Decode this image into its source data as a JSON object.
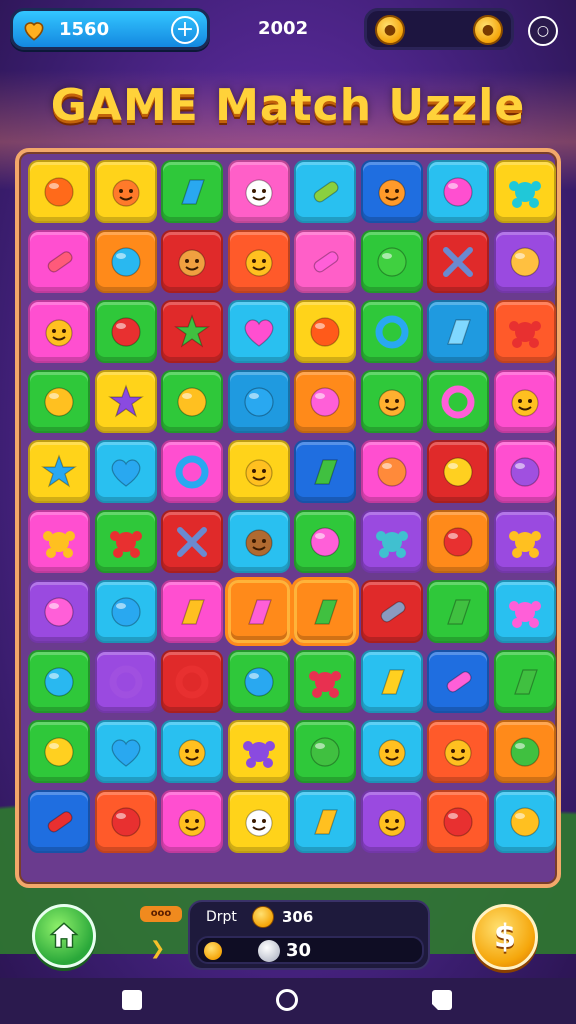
{
  "header": {
    "lives_value": "1560",
    "center_value": "2002",
    "title": "GAME Match Uzzle"
  },
  "board": {
    "rows": [
      [
        {
          "c": "#ffd31a",
          "i": "orange-fruit"
        },
        {
          "c": "#ffd31a",
          "i": "smile-pumpkin"
        },
        {
          "c": "#2fc83a",
          "i": "lightning-shape"
        },
        {
          "c": "#ff5fc8",
          "i": "cat-face"
        },
        {
          "c": "#29c0f0",
          "i": "sticks"
        },
        {
          "c": "#1f6ee0",
          "i": "round-creature"
        },
        {
          "c": "#29c0f0",
          "i": "pink-blob"
        },
        {
          "c": "#ffd31a",
          "i": "teal-flower"
        }
      ],
      [
        {
          "c": "#ff4fd0",
          "i": "brush"
        },
        {
          "c": "#ff8a1a",
          "i": "blue-orb"
        },
        {
          "c": "#e02a2a",
          "i": "monster-face"
        },
        {
          "c": "#ff5a2a",
          "i": "sun-face"
        },
        {
          "c": "#ff5fc8",
          "i": "pink-bar"
        },
        {
          "c": "#2fc83a",
          "i": "green-orb"
        },
        {
          "c": "#e02a2a",
          "i": "cross-swords"
        },
        {
          "c": "#9a4ae0",
          "i": "hand-glove"
        }
      ],
      [
        {
          "c": "#ff4fd0",
          "i": "smile-drop"
        },
        {
          "c": "#2fc83a",
          "i": "red-ball"
        },
        {
          "c": "#e02a2a",
          "i": "green-star"
        },
        {
          "c": "#29c0f0",
          "i": "heart"
        },
        {
          "c": "#ffd31a",
          "i": "orange-ball"
        },
        {
          "c": "#2fc83a",
          "i": "blue-ring"
        },
        {
          "c": "#1f9ae0",
          "i": "blue-gem"
        },
        {
          "c": "#ff5a2a",
          "i": "red-splat"
        }
      ],
      [
        {
          "c": "#2fc83a",
          "i": "lemon"
        },
        {
          "c": "#ffd31a",
          "i": "purple-star"
        },
        {
          "c": "#2fc83a",
          "i": "swirl-disc"
        },
        {
          "c": "#1f9ae0",
          "i": "blue-ball"
        },
        {
          "c": "#ff8a1a",
          "i": "pink-swirl"
        },
        {
          "c": "#2fc83a",
          "i": "bear-face"
        },
        {
          "c": "#2fc83a",
          "i": "pink-ring"
        },
        {
          "c": "#ff4fd0",
          "i": "sun-smile"
        }
      ],
      [
        {
          "c": "#ffd31a",
          "i": "blue-star"
        },
        {
          "c": "#29c0f0",
          "i": "blue-heart"
        },
        {
          "c": "#ff4fd0",
          "i": "blue-ring"
        },
        {
          "c": "#ffd31a",
          "i": "sun-face"
        },
        {
          "c": "#1f6ee0",
          "i": "green-shard"
        },
        {
          "c": "#ff4fd0",
          "i": "orange-swirl"
        },
        {
          "c": "#e02a2a",
          "i": "yellow-ball"
        },
        {
          "c": "#ff4fd0",
          "i": "purple-disc"
        }
      ],
      [
        {
          "c": "#ff4fd0",
          "i": "sparkle-cone"
        },
        {
          "c": "#2fc83a",
          "i": "red-splat"
        },
        {
          "c": "#e02a2a",
          "i": "cross-swords"
        },
        {
          "c": "#29c0f0",
          "i": "chestnut-face"
        },
        {
          "c": "#2fc83a",
          "i": "pink-jelly"
        },
        {
          "c": "#9a4ae0",
          "i": "flower-bug"
        },
        {
          "c": "#ff8a1a",
          "i": "red-swirl"
        },
        {
          "c": "#9a4ae0",
          "i": "spark"
        }
      ],
      [
        {
          "c": "#9a4ae0",
          "i": "pink-dice"
        },
        {
          "c": "#29c0f0",
          "i": "balloon"
        },
        {
          "c": "#ff4fd0",
          "i": "yellow-leaf"
        },
        {
          "c": "#ff8a1a",
          "i": "pink-boot",
          "hl": true
        },
        {
          "c": "#ff8a1a",
          "i": "green-shard",
          "hl": true
        },
        {
          "c": "#e02a2a",
          "i": "microphone"
        },
        {
          "c": "#2fc83a",
          "i": "green-bolt"
        },
        {
          "c": "#29c0f0",
          "i": "pink-splat"
        }
      ],
      [
        {
          "c": "#2fc83a",
          "i": "blue-orb"
        },
        {
          "c": "#9a4ae0",
          "i": "purple-ring"
        },
        {
          "c": "#e02a2a",
          "i": "red-ring"
        },
        {
          "c": "#2fc83a",
          "i": "blue-shield"
        },
        {
          "c": "#2fc83a",
          "i": "red-flower"
        },
        {
          "c": "#29c0f0",
          "i": "yellow-gem"
        },
        {
          "c": "#1f6ee0",
          "i": "pink-bar"
        },
        {
          "c": "#2fc83a",
          "i": "green-leaf"
        }
      ],
      [
        {
          "c": "#2fc83a",
          "i": "yellow-fruit"
        },
        {
          "c": "#29c0f0",
          "i": "blue-heart"
        },
        {
          "c": "#29c0f0",
          "i": "sun-smile"
        },
        {
          "c": "#ffd31a",
          "i": "purple-bug"
        },
        {
          "c": "#2fc83a",
          "i": "green-ball"
        },
        {
          "c": "#29c0f0",
          "i": "sun-face"
        },
        {
          "c": "#ff5a2a",
          "i": "sun-face"
        },
        {
          "c": "#ff8a1a",
          "i": "green-hook"
        }
      ],
      [
        {
          "c": "#1f6ee0",
          "i": "red-cracker"
        },
        {
          "c": "#ff5a2a",
          "i": "red-swirl"
        },
        {
          "c": "#ff4fd0",
          "i": "sun-smile"
        },
        {
          "c": "#ffd31a",
          "i": "cat-face"
        },
        {
          "c": "#29c0f0",
          "i": "yellow-leaf"
        },
        {
          "c": "#9a4ae0",
          "i": "sun-face"
        },
        {
          "c": "#ff5a2a",
          "i": "red-boxing"
        },
        {
          "c": "#29c0f0",
          "i": "yellow-disc"
        }
      ]
    ]
  },
  "footer": {
    "tag_label": "ooo",
    "stats_label": "Drpt",
    "coins_value": "306",
    "progress_value": "30",
    "shop_symbol": "$"
  }
}
